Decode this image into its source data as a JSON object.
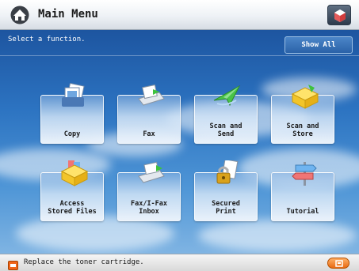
{
  "header": {
    "title": "Main Menu",
    "home_icon": "home-icon",
    "right_button_icon": "counter-check-icon"
  },
  "content": {
    "instruction": "Select a function.",
    "show_all_label": "Show All"
  },
  "tiles": [
    {
      "label": "Copy",
      "icon": "copy-icon"
    },
    {
      "label": "Fax",
      "icon": "fax-icon"
    },
    {
      "label": "Scan and\nSend",
      "icon": "scan-send-icon"
    },
    {
      "label": "Scan and\nStore",
      "icon": "scan-store-icon"
    },
    {
      "label": "Access\nStored Files",
      "icon": "stored-files-icon"
    },
    {
      "label": "Fax/I-Fax\nInbox",
      "icon": "fax-inbox-icon"
    },
    {
      "label": "Secured\nPrint",
      "icon": "secured-print-icon"
    },
    {
      "label": "Tutorial",
      "icon": "tutorial-icon"
    }
  ],
  "status": {
    "message": "Replace the toner cartridge.",
    "alert_icon": "toner-alert-icon",
    "button_icon": "status-monitor-icon",
    "button_color": "#e86a12"
  },
  "colors": {
    "background_top": "#1d55a0",
    "background_bottom": "#7fb4e3",
    "header": "#eef2f6"
  }
}
